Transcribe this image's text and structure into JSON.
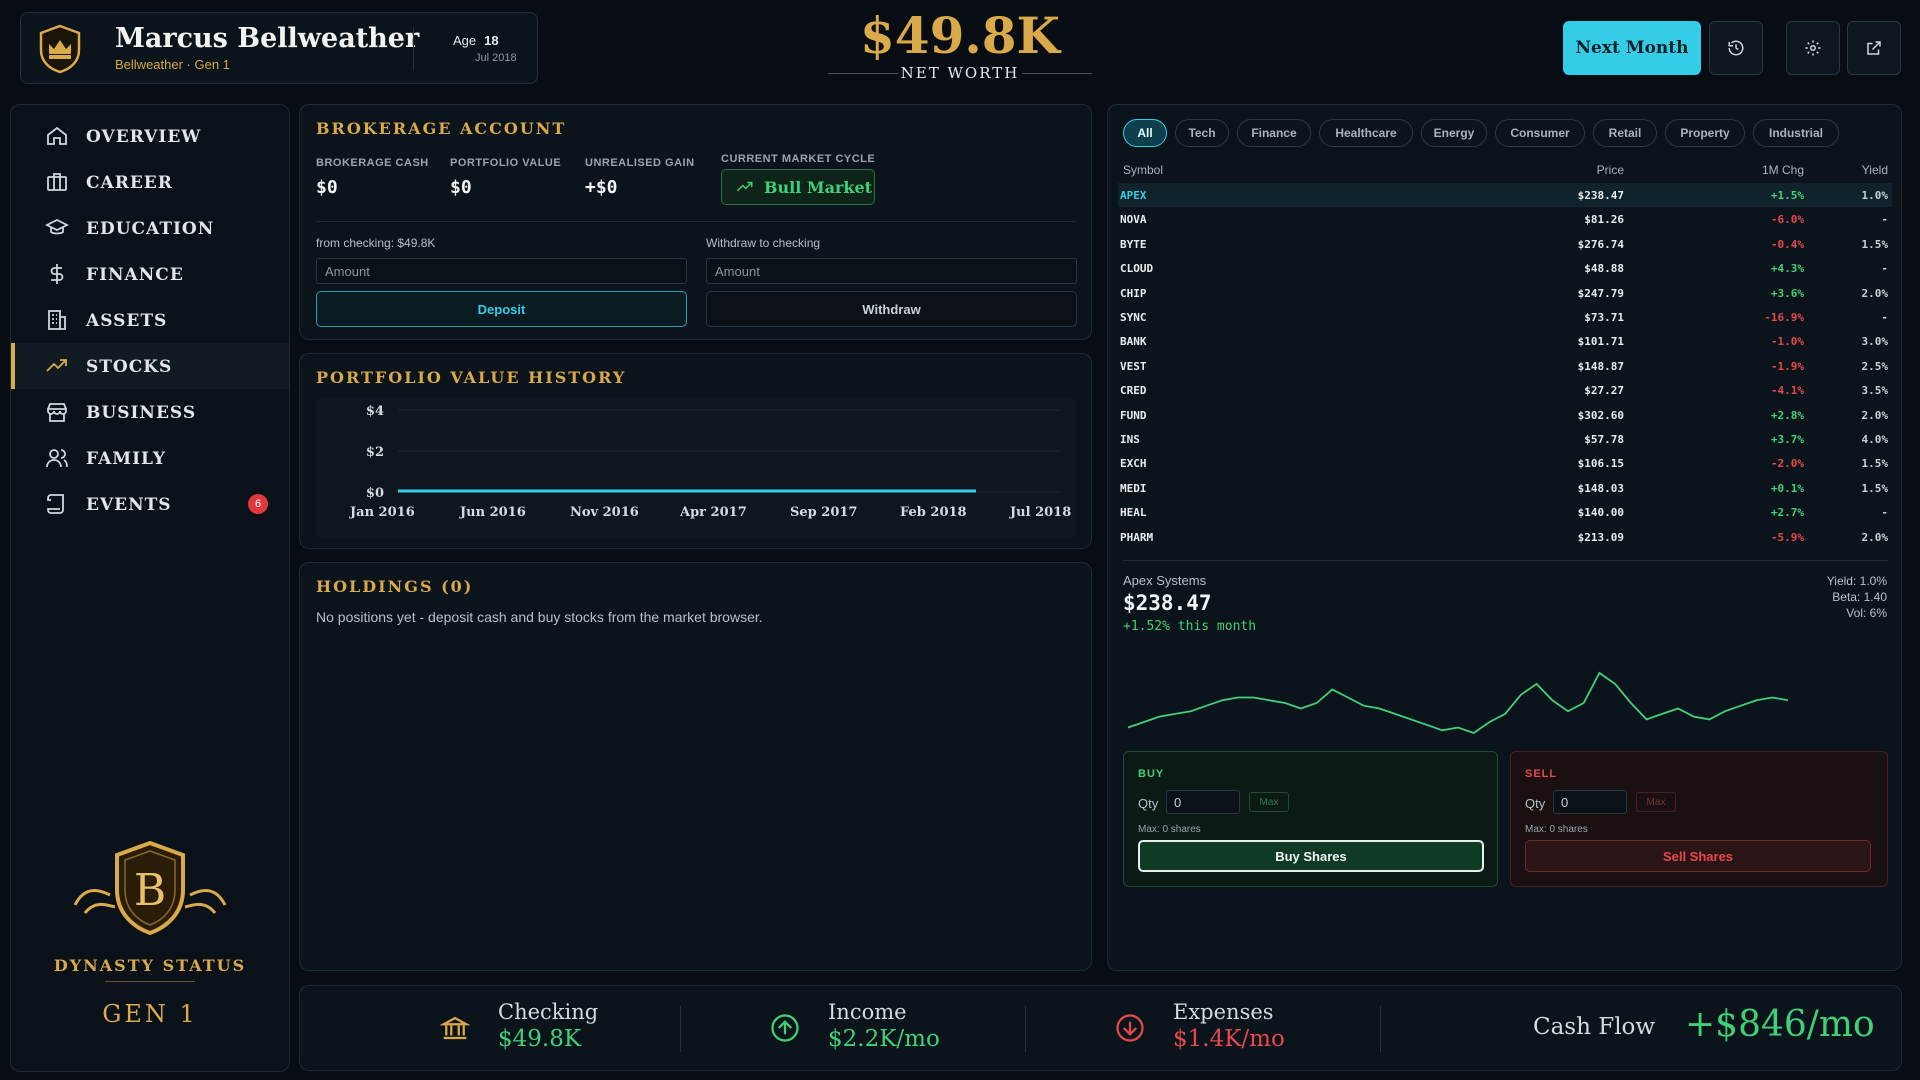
{
  "header": {
    "name": "Marcus Bellweather",
    "subtitle": "Bellweather · Gen 1",
    "age_label": "Age",
    "age": "18",
    "date": "Jul 2018",
    "net_worth": "$49.8K",
    "net_worth_label": "NET WORTH",
    "next_month_label": "Next Month"
  },
  "sidebar": {
    "items": [
      {
        "label": "OVERVIEW",
        "icon": "home-icon"
      },
      {
        "label": "CAREER",
        "icon": "briefcase-icon"
      },
      {
        "label": "EDUCATION",
        "icon": "graduation-cap-icon"
      },
      {
        "label": "FINANCE",
        "icon": "dollar-icon"
      },
      {
        "label": "ASSETS",
        "icon": "building-icon"
      },
      {
        "label": "STOCKS",
        "icon": "trending-up-icon"
      },
      {
        "label": "BUSINESS",
        "icon": "store-icon"
      },
      {
        "label": "FAMILY",
        "icon": "users-icon"
      },
      {
        "label": "EVENTS",
        "icon": "scroll-icon"
      }
    ],
    "active_index": 5,
    "events_badge": "6",
    "dynasty_letter": "B",
    "dynasty_label": "DYNASTY STATUS",
    "dynasty_gen": "GEN 1"
  },
  "brokerage": {
    "title": "BROKERAGE ACCOUNT",
    "cash_label": "BROKERAGE CASH",
    "cash": "$0",
    "portfolio_label": "PORTFOLIO VALUE",
    "portfolio": "$0",
    "gain_label": "UNREALISED GAIN",
    "gain": "+$0",
    "cycle_label": "CURRENT MARKET CYCLE",
    "cycle": "Bull Market",
    "deposit_caption": "from checking: $49.8K",
    "withdraw_caption": "Withdraw to checking",
    "amount_placeholder": "Amount",
    "deposit_label": "Deposit",
    "withdraw_label": "Withdraw"
  },
  "history": {
    "title": "PORTFOLIO VALUE HISTORY"
  },
  "chart_data": {
    "type": "line",
    "title": "PORTFOLIO VALUE HISTORY",
    "x": [
      "Jan 2016",
      "Jun 2016",
      "Nov 2016",
      "Apr 2017",
      "Sep 2017",
      "Feb 2018",
      "Jul 2018"
    ],
    "x_tick_labels": [
      "Jan 2016",
      "Jun 2016",
      "Nov 2016",
      "Apr 2017",
      "Sep 2017",
      "Feb 2018",
      "Jul 2018"
    ],
    "series": [
      {
        "values": [
          0,
          0,
          0,
          0,
          0,
          0,
          0
        ]
      }
    ],
    "y_ticks": [
      "$0",
      "$2",
      "$4"
    ],
    "ylim": [
      0,
      4
    ],
    "grid": true,
    "color": "#35cde6"
  },
  "holdings": {
    "title": "HOLDINGS (0)",
    "empty_text": "No positions yet - deposit cash and buy stocks from the market browser."
  },
  "market": {
    "filters": [
      "All",
      "Tech",
      "Finance",
      "Healthcare",
      "Energy",
      "Consumer",
      "Retail",
      "Property",
      "Industrial"
    ],
    "columns": [
      "Symbol",
      "Price",
      "1M Chg",
      "Yield"
    ],
    "rows": [
      {
        "symbol": "APEX",
        "price": "$238.47",
        "chg": "+1.5%",
        "yield": "1.0%"
      },
      {
        "symbol": "NOVA",
        "price": "$81.26",
        "chg": "-6.0%",
        "yield": "-"
      },
      {
        "symbol": "BYTE",
        "price": "$276.74",
        "chg": "-0.4%",
        "yield": "1.5%"
      },
      {
        "symbol": "CLOUD",
        "price": "$48.88",
        "chg": "+4.3%",
        "yield": "-"
      },
      {
        "symbol": "CHIP",
        "price": "$247.79",
        "chg": "+3.6%",
        "yield": "2.0%"
      },
      {
        "symbol": "SYNC",
        "price": "$73.71",
        "chg": "-16.9%",
        "yield": "-"
      },
      {
        "symbol": "BANK",
        "price": "$101.71",
        "chg": "-1.0%",
        "yield": "3.0%"
      },
      {
        "symbol": "VEST",
        "price": "$148.87",
        "chg": "-1.9%",
        "yield": "2.5%"
      },
      {
        "symbol": "CRED",
        "price": "$27.27",
        "chg": "-4.1%",
        "yield": "3.5%"
      },
      {
        "symbol": "FUND",
        "price": "$302.60",
        "chg": "+2.8%",
        "yield": "2.0%"
      },
      {
        "symbol": "INS",
        "price": "$57.78",
        "chg": "+3.7%",
        "yield": "4.0%"
      },
      {
        "symbol": "EXCH",
        "price": "$106.15",
        "chg": "-2.0%",
        "yield": "1.5%"
      },
      {
        "symbol": "MEDI",
        "price": "$148.03",
        "chg": "+0.1%",
        "yield": "1.5%"
      },
      {
        "symbol": "HEAL",
        "price": "$140.00",
        "chg": "+2.7%",
        "yield": "-"
      },
      {
        "symbol": "PHARM",
        "price": "$213.09",
        "chg": "-5.9%",
        "yield": "2.0%"
      }
    ],
    "detail": {
      "name": "Apex Systems",
      "price": "$238.47",
      "change": "+1.52% this month",
      "yield": "Yield: 1.0%",
      "beta": "Beta: 1.40",
      "vol": "Vol: 6%",
      "sparkline": [
        21,
        23,
        25,
        26,
        27,
        29,
        31,
        32,
        32,
        31,
        30,
        28,
        30,
        35,
        32,
        29,
        28,
        26,
        24,
        22,
        20,
        21,
        19,
        23,
        26,
        33,
        37,
        31,
        27,
        30,
        41,
        37,
        30,
        24,
        26,
        28,
        25,
        24,
        27,
        29,
        31,
        32,
        31
      ]
    },
    "buy": {
      "title": "BUY",
      "qty_label": "Qty",
      "qty": "0",
      "max_label": "Max",
      "max_text": "Max: 0 shares",
      "button": "Buy Shares"
    },
    "sell": {
      "title": "SELL",
      "qty_label": "Qty",
      "qty": "0",
      "max_label": "Max",
      "max_text": "Max: 0 shares",
      "button": "Sell Shares"
    }
  },
  "footer": {
    "checking_label": "Checking",
    "checking": "$49.8K",
    "income_label": "Income",
    "income": "$2.2K/mo",
    "expenses_label": "Expenses",
    "expenses": "$1.4K/mo",
    "cashflow_label": "Cash Flow",
    "cashflow": "+$846/mo"
  },
  "colors": {
    "gold": "#d9a94a",
    "cyan": "#35cde6",
    "green": "#3fd17a",
    "red": "#e5484d"
  }
}
